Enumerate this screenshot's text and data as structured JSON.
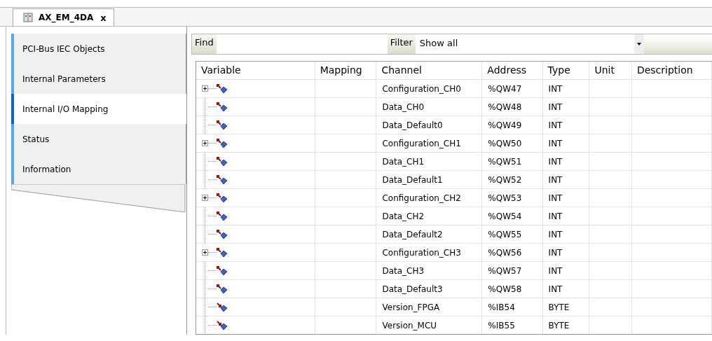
{
  "tab": {
    "title": "AX_EM_4DA",
    "close": "x"
  },
  "sidebar": {
    "items": [
      {
        "label": "PCI-Bus IEC Objects",
        "selected": false
      },
      {
        "label": "Internal Parameters",
        "selected": false
      },
      {
        "label": "Internal I/O Mapping",
        "selected": true
      },
      {
        "label": "Status",
        "selected": false
      },
      {
        "label": "Information",
        "selected": false
      }
    ]
  },
  "find": {
    "label": "Find"
  },
  "filter": {
    "label": "Filter",
    "value": "Show all"
  },
  "table": {
    "columns": [
      "Variable",
      "Mapping",
      "Channel",
      "Address",
      "Type",
      "Unit",
      "Description"
    ],
    "rows": [
      {
        "kind": "output",
        "expandable": true,
        "channel": "Configuration_CH0",
        "address": "%QW47",
        "type": "INT"
      },
      {
        "kind": "output",
        "expandable": false,
        "channel": "Data_CH0",
        "address": "%QW48",
        "type": "INT"
      },
      {
        "kind": "output",
        "expandable": false,
        "channel": "Data_Default0",
        "address": "%QW49",
        "type": "INT"
      },
      {
        "kind": "output",
        "expandable": true,
        "channel": "Configuration_CH1",
        "address": "%QW50",
        "type": "INT"
      },
      {
        "kind": "output",
        "expandable": false,
        "channel": "Data_CH1",
        "address": "%QW51",
        "type": "INT"
      },
      {
        "kind": "output",
        "expandable": false,
        "channel": "Data_Default1",
        "address": "%QW52",
        "type": "INT"
      },
      {
        "kind": "output",
        "expandable": true,
        "channel": "Configuration_CH2",
        "address": "%QW53",
        "type": "INT"
      },
      {
        "kind": "output",
        "expandable": false,
        "channel": "Data_CH2",
        "address": "%QW54",
        "type": "INT"
      },
      {
        "kind": "output",
        "expandable": false,
        "channel": "Data_Default2",
        "address": "%QW55",
        "type": "INT"
      },
      {
        "kind": "output",
        "expandable": true,
        "channel": "Configuration_CH3",
        "address": "%QW56",
        "type": "INT"
      },
      {
        "kind": "output",
        "expandable": false,
        "channel": "Data_CH3",
        "address": "%QW57",
        "type": "INT"
      },
      {
        "kind": "output",
        "expandable": false,
        "channel": "Data_Default3",
        "address": "%QW58",
        "type": "INT"
      },
      {
        "kind": "input",
        "expandable": false,
        "channel": "Version_FPGA",
        "address": "%IB54",
        "type": "BYTE"
      },
      {
        "kind": "input",
        "expandable": false,
        "channel": "Version_MCU",
        "address": "%IB55",
        "type": "BYTE"
      }
    ]
  }
}
